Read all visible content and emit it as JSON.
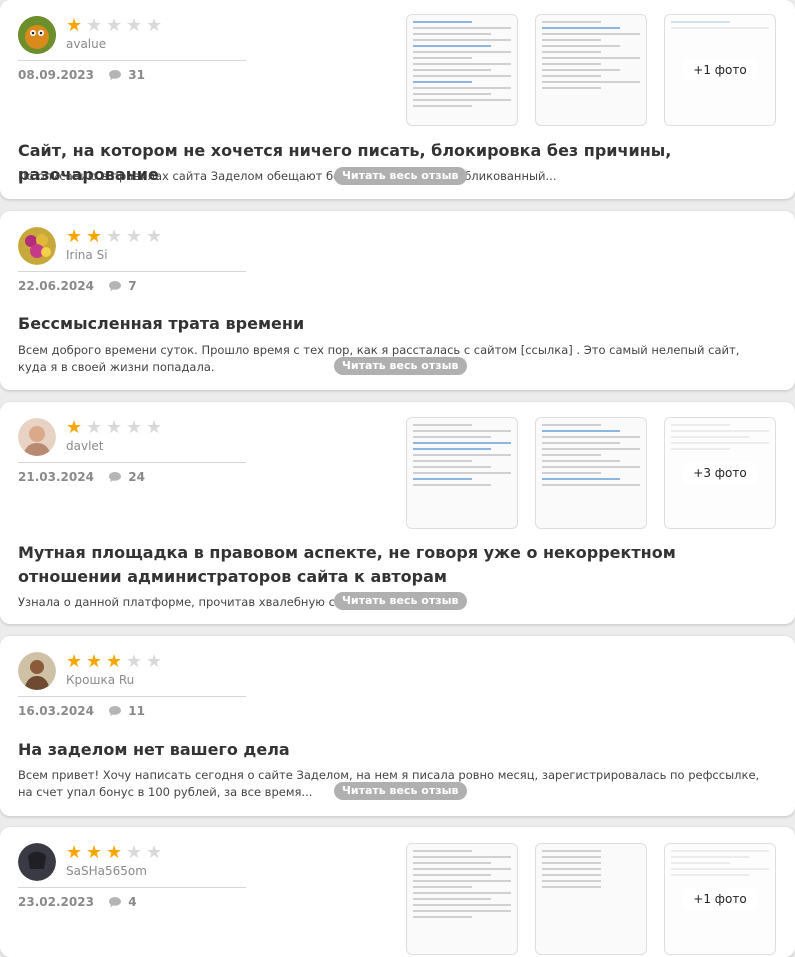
{
  "read_more_label": "Читать весь отзыв",
  "colors": {
    "star_on": "#f7a600",
    "star_off": "#d9d9d9",
    "pill": "#b0b0b0"
  },
  "reviews": [
    {
      "author": "avalue",
      "rating": 1,
      "date": "08.09.2023",
      "comments": "31",
      "title": "Сайт, на котором не хочется ничего писать, блокировка без причины, разочарование",
      "excerpt": "По описанию в правилах сайта Заделом обещают бонусы за каждый опубликованный...",
      "photos_more": "+1 фото"
    },
    {
      "author": "Irina Si",
      "rating": 2,
      "date": "22.06.2024",
      "comments": "7",
      "title": "Бессмысленная трата времени",
      "excerpt": "Всем доброго времени суток. Прошло время с тех пор, как я рассталась с сайтом [ссылка] . Это самый нелепый сайт, куда я в своей жизни попадала."
    },
    {
      "author": "davlet",
      "rating": 1,
      "date": "21.03.2024",
      "comments": "24",
      "title": "Мутная площадка в правовом аспекте, не говоря уже о некорректном отношении администраторов сайта к авторам",
      "excerpt": "Узнала о данной платформе, прочитав хвалебную статью...",
      "photos_more": "+3 фото"
    },
    {
      "author": "Крошка Ru",
      "rating": 3,
      "date": "16.03.2024",
      "comments": "11",
      "title": "На заделом нет вашего дела",
      "excerpt": "Всем привет! Хочу написать сегодня о сайте Заделом, на нем я писала ровно месяц, зарегистрировалась по рефссылке, на счет упал бонус в 100 рублей, за все время..."
    },
    {
      "author": "SaSHa565om",
      "rating": 3,
      "date": "23.02.2023",
      "comments": "4",
      "photos_more": "+1 фото"
    }
  ]
}
